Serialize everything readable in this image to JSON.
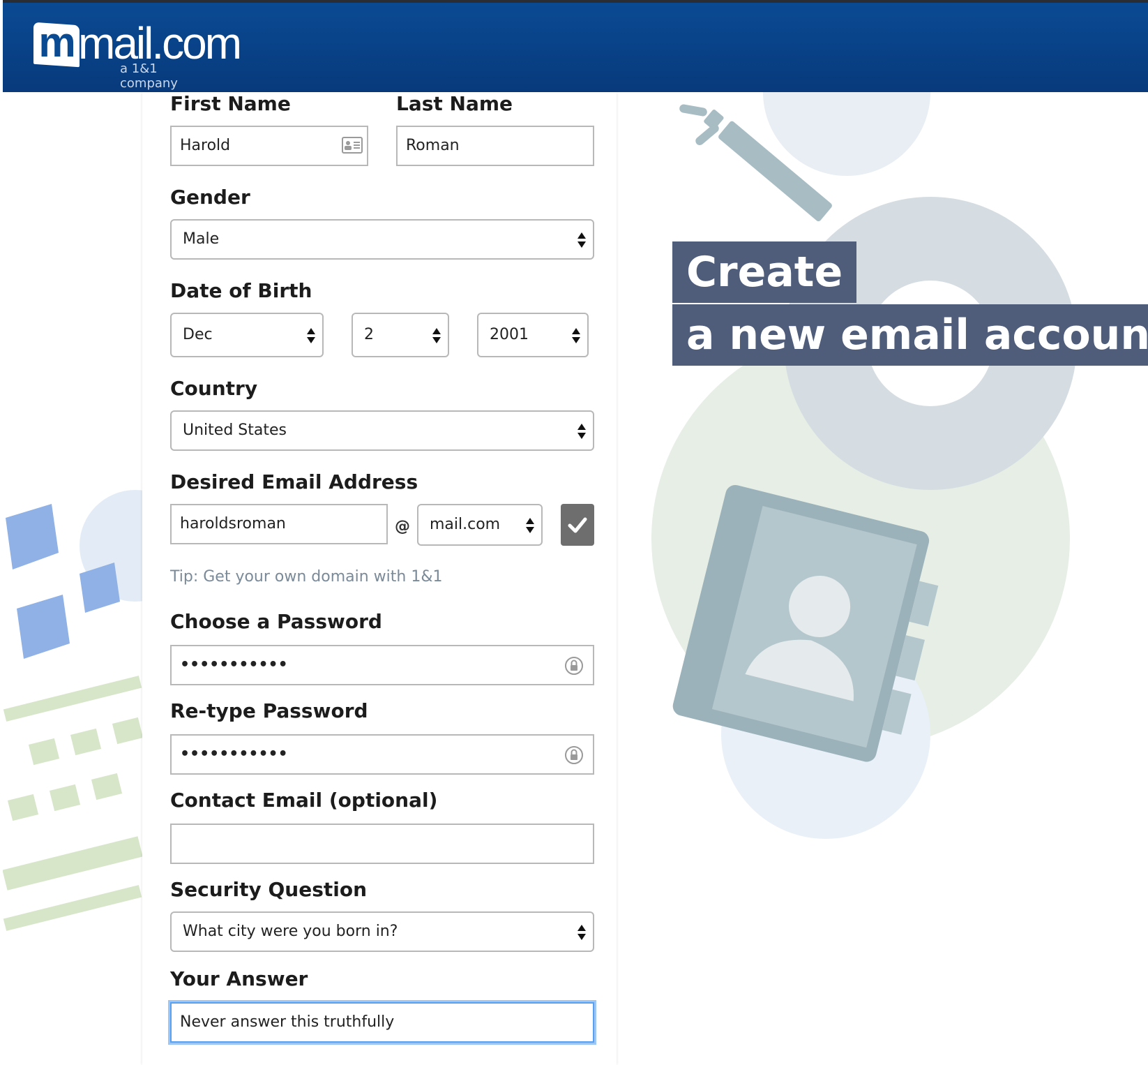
{
  "header": {
    "logo_text": "mail.com",
    "logo_tagline": "a 1&1 company"
  },
  "promo": {
    "line1": "Create",
    "line2": "a new email account"
  },
  "form": {
    "first_name": {
      "label": "First Name",
      "value": "Harold"
    },
    "last_name": {
      "label": "Last Name",
      "value": "Roman"
    },
    "gender": {
      "label": "Gender",
      "value": "Male"
    },
    "dob": {
      "label": "Date of Birth",
      "month": "Dec",
      "day": "2",
      "year": "2001"
    },
    "country": {
      "label": "Country",
      "value": "United States"
    },
    "email": {
      "label": "Desired Email Address",
      "username": "haroldsroman",
      "at": "@",
      "domain": "mail.com",
      "tip": "Tip: Get your own domain with 1&1"
    },
    "password": {
      "label": "Choose a Password",
      "masked": "•••••••••••"
    },
    "retype_password": {
      "label": "Re-type Password",
      "masked": "•••••••••••"
    },
    "contact_email": {
      "label": "Contact Email (optional)",
      "value": ""
    },
    "security_question": {
      "label": "Security Question",
      "value": "What city were you born in?"
    },
    "answer": {
      "label": "Your Answer",
      "value": "Never answer this truthfully"
    }
  },
  "colors": {
    "header_bg": "#0a4a93",
    "promo_bg": "#4f5d7b",
    "focus_ring": "#5aa0f0",
    "check_button": "#6e6e6e"
  }
}
